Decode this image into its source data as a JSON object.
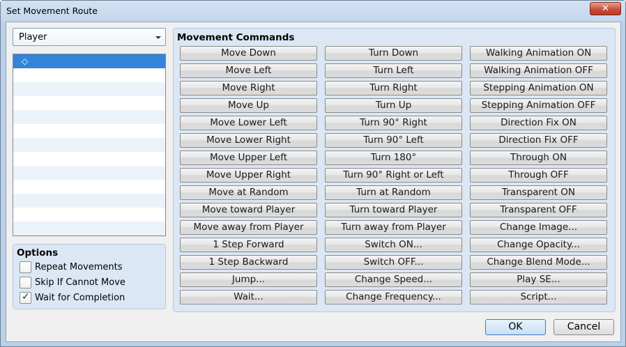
{
  "window": {
    "title": "Set Movement Route",
    "close_label": "✕"
  },
  "target": {
    "selected": "Player"
  },
  "route_list": {
    "first_item_symbol": "◇",
    "row_count": 13
  },
  "options": {
    "title": "Options",
    "items": [
      {
        "label": "Repeat Movements",
        "checked": false
      },
      {
        "label": "Skip If Cannot Move",
        "checked": false
      },
      {
        "label": "Wait for Completion",
        "checked": true
      }
    ],
    "check_symbol": "✓"
  },
  "commands": {
    "title": "Movement Commands",
    "columns": [
      [
        "Move Down",
        "Move Left",
        "Move Right",
        "Move Up",
        "Move Lower Left",
        "Move Lower Right",
        "Move Upper Left",
        "Move Upper Right",
        "Move at Random",
        "Move toward Player",
        "Move away from Player",
        "1 Step Forward",
        "1 Step Backward",
        "Jump...",
        "Wait..."
      ],
      [
        "Turn Down",
        "Turn Left",
        "Turn Right",
        "Turn Up",
        "Turn 90° Right",
        "Turn 90° Left",
        "Turn 180°",
        "Turn 90° Right or Left",
        "Turn at Random",
        "Turn toward Player",
        "Turn away from Player",
        "Switch ON...",
        "Switch OFF...",
        "Change Speed...",
        "Change Frequency..."
      ],
      [
        "Walking Animation ON",
        "Walking Animation OFF",
        "Stepping Animation ON",
        "Stepping Animation OFF",
        "Direction Fix ON",
        "Direction Fix OFF",
        "Through ON",
        "Through OFF",
        "Transparent ON",
        "Transparent OFF",
        "Change Image...",
        "Change Opacity...",
        "Change Blend Mode...",
        "Play SE...",
        "Script..."
      ]
    ]
  },
  "buttons": {
    "ok": "OK",
    "cancel": "Cancel"
  }
}
